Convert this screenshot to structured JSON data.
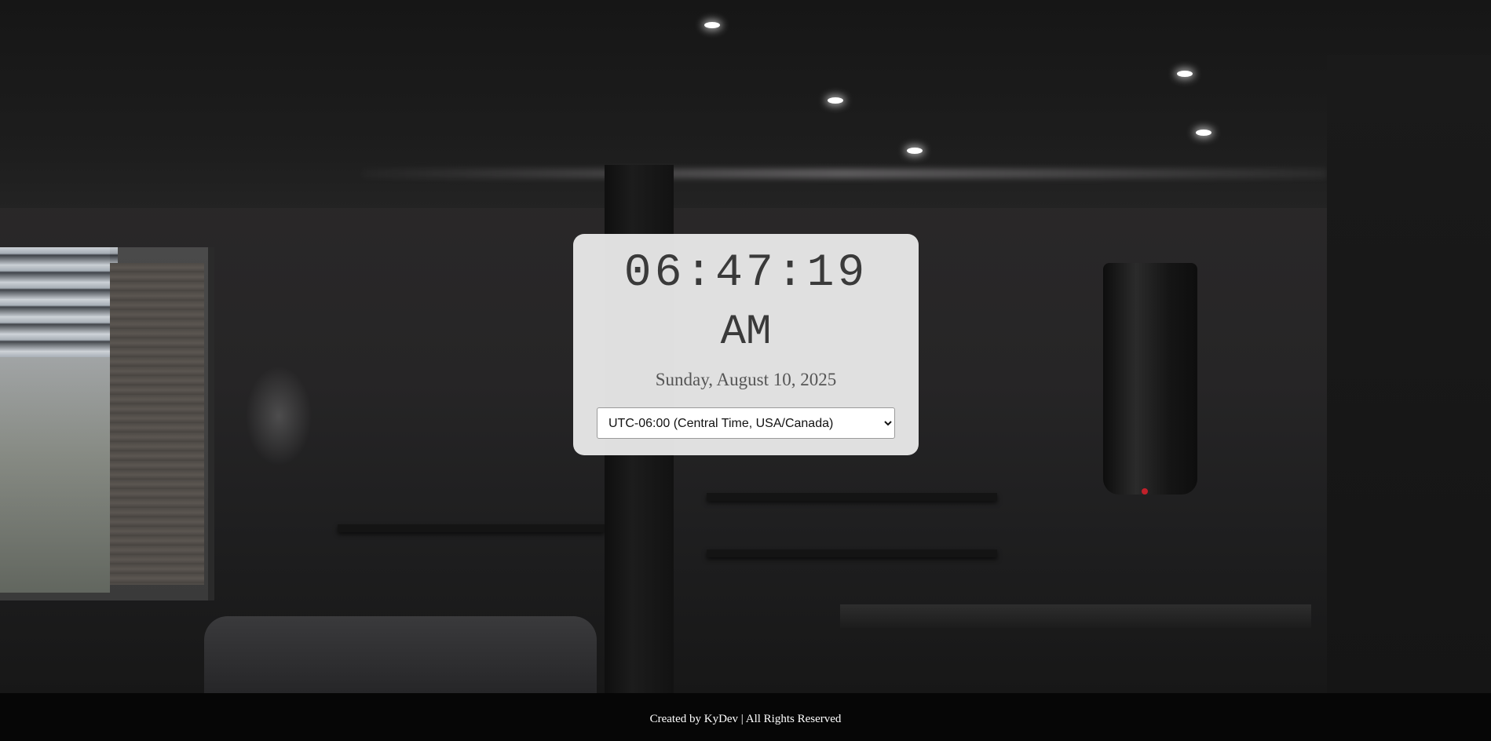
{
  "clock": {
    "time": "06:47:19",
    "ampm": "AM",
    "date": "Sunday, August 10, 2025"
  },
  "timezone": {
    "selected": "UTC-06:00 (Central Time, USA/Canada)",
    "options": [
      "UTC-06:00 (Central Time, USA/Canada)"
    ]
  },
  "footer": {
    "text": "Created by KyDev | All Rights Reserved"
  },
  "colors": {
    "card_background": "#e6e6e6",
    "clock_text": "#3a3a3a",
    "footer_background": "#060606",
    "footer_text": "#ffffff"
  }
}
